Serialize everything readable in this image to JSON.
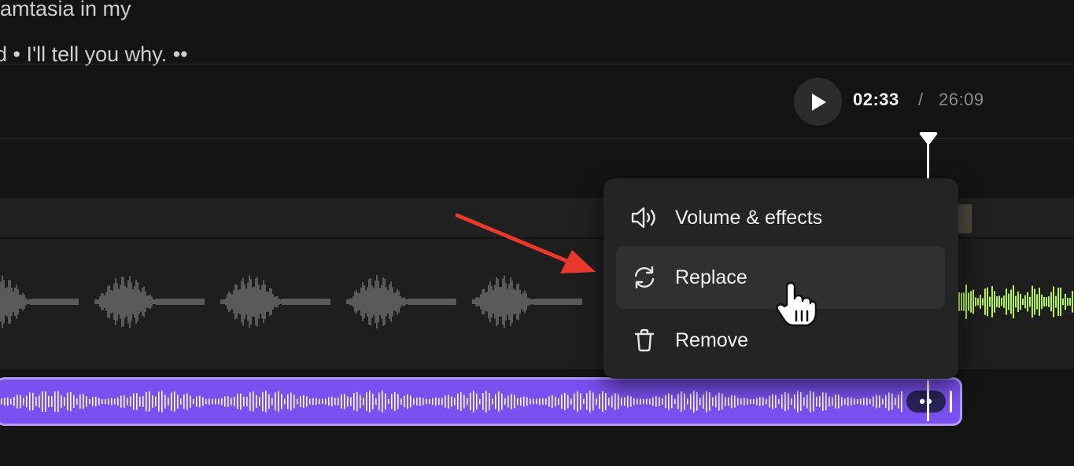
{
  "transcript": {
    "line1": "amtasia in my",
    "line2": "d • I'll tell you why. ••"
  },
  "player": {
    "current_time": "02:33",
    "separator": "/",
    "total_time": "26:09",
    "play_icon": "play-icon"
  },
  "context_menu": {
    "items": [
      {
        "label": "Volume & effects",
        "icon": "speaker-icon"
      },
      {
        "label": "Replace",
        "icon": "refresh-icon"
      },
      {
        "label": "Remove",
        "icon": "trash-icon"
      }
    ],
    "hovered": "Replace"
  },
  "music_clip": {
    "handle_label": "••"
  },
  "colors": {
    "background": "#141414",
    "music_clip": "#7b50f0",
    "music_clip_border": "#b09bff",
    "waveform_gray": "#5a5a5a",
    "waveform_green": "#b6f24d",
    "annotation_arrow": "#e8392c"
  }
}
